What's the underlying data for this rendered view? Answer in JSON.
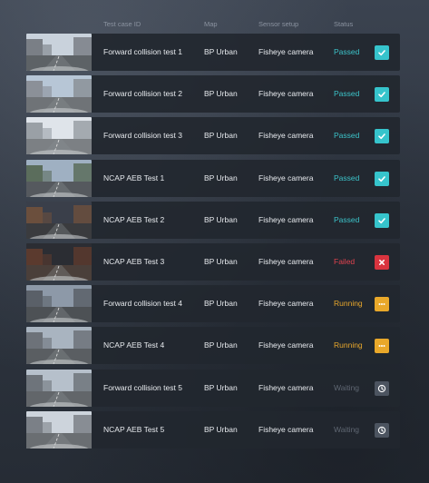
{
  "header": {
    "test_case_id": "Test case ID",
    "map": "Map",
    "sensor_setup": "Sensor setup",
    "status": "Status"
  },
  "rows": [
    {
      "name": "Forward collision test 1",
      "map": "BP Urban",
      "sensor": "Fisheye camera",
      "status": "Passed",
      "state": "passed",
      "icon": "check-icon"
    },
    {
      "name": "Forward collision test 2",
      "map": "BP Urban",
      "sensor": "Fisheye camera",
      "status": "Passed",
      "state": "passed",
      "icon": "check-icon"
    },
    {
      "name": "Forward collision test 3",
      "map": "BP Urban",
      "sensor": "Fisheye camera",
      "status": "Passed",
      "state": "passed",
      "icon": "check-icon"
    },
    {
      "name": "NCAP AEB Test 1",
      "map": "BP Urban",
      "sensor": "Fisheye camera",
      "status": "Passed",
      "state": "passed",
      "icon": "check-icon"
    },
    {
      "name": "NCAP AEB Test 2",
      "map": "BP Urban",
      "sensor": "Fisheye camera",
      "status": "Passed",
      "state": "passed",
      "icon": "check-icon"
    },
    {
      "name": "NCAP AEB Test 3",
      "map": "BP Urban",
      "sensor": "Fisheye camera",
      "status": "Failed",
      "state": "failed",
      "icon": "close-icon"
    },
    {
      "name": "Forward collision test 4",
      "map": "BP Urban",
      "sensor": "Fisheye camera",
      "status": "Running",
      "state": "running",
      "icon": "more-icon"
    },
    {
      "name": "NCAP AEB Test 4",
      "map": "BP Urban",
      "sensor": "Fisheye camera",
      "status": "Running",
      "state": "running",
      "icon": "more-icon"
    },
    {
      "name": "Forward collision test 5",
      "map": "BP Urban",
      "sensor": "Fisheye camera",
      "status": "Waiting",
      "state": "waiting",
      "icon": "clock-icon"
    },
    {
      "name": "NCAP AEB Test 5",
      "map": "BP Urban",
      "sensor": "Fisheye camera",
      "status": "Waiting",
      "state": "waiting",
      "icon": "clock-icon"
    }
  ],
  "colors": {
    "passed": "#36c4cc",
    "failed": "#d9343f",
    "running": "#e9a82a",
    "waiting": "#4c5460"
  }
}
